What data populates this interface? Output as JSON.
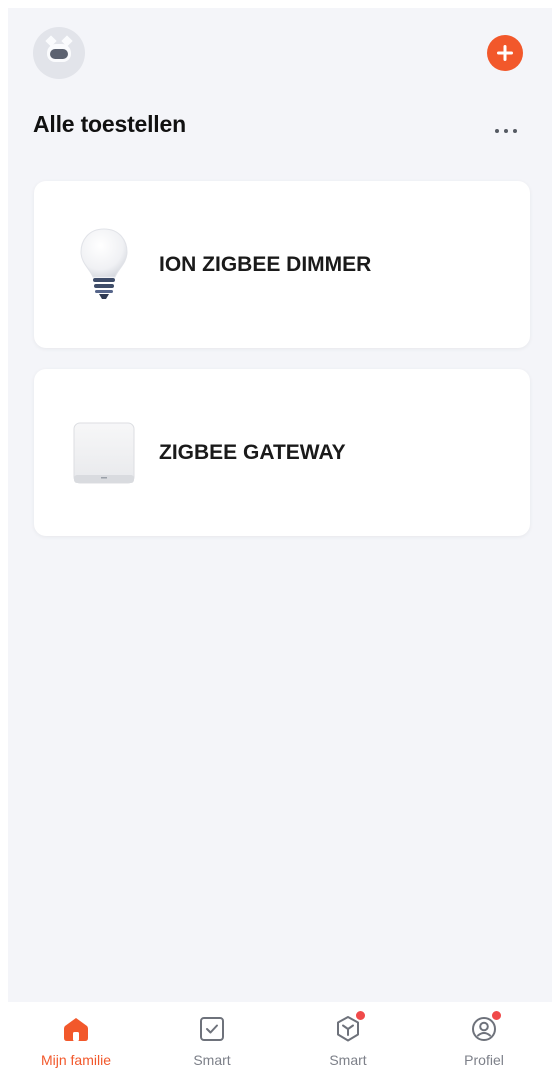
{
  "header": {
    "title": "Alle toestellen"
  },
  "devices": [
    {
      "name": "ION ZIGBEE DIMMER",
      "icon": "lightbulb-icon"
    },
    {
      "name": "ZIGBEE GATEWAY",
      "icon": "gateway-icon"
    }
  ],
  "tabbar": {
    "tabs": [
      {
        "label": "Mijn familie",
        "icon": "home-icon",
        "active": true,
        "badge": false
      },
      {
        "label": "Smart",
        "icon": "checkbox-icon",
        "active": false,
        "badge": false
      },
      {
        "label": "Smart",
        "icon": "cube-icon",
        "active": false,
        "badge": true
      },
      {
        "label": "Profiel",
        "icon": "profile-icon",
        "active": false,
        "badge": true
      }
    ]
  },
  "colors": {
    "accent": "#f2582b",
    "badge": "#f04a4a",
    "background": "#f4f5f9",
    "card": "#ffffff"
  }
}
